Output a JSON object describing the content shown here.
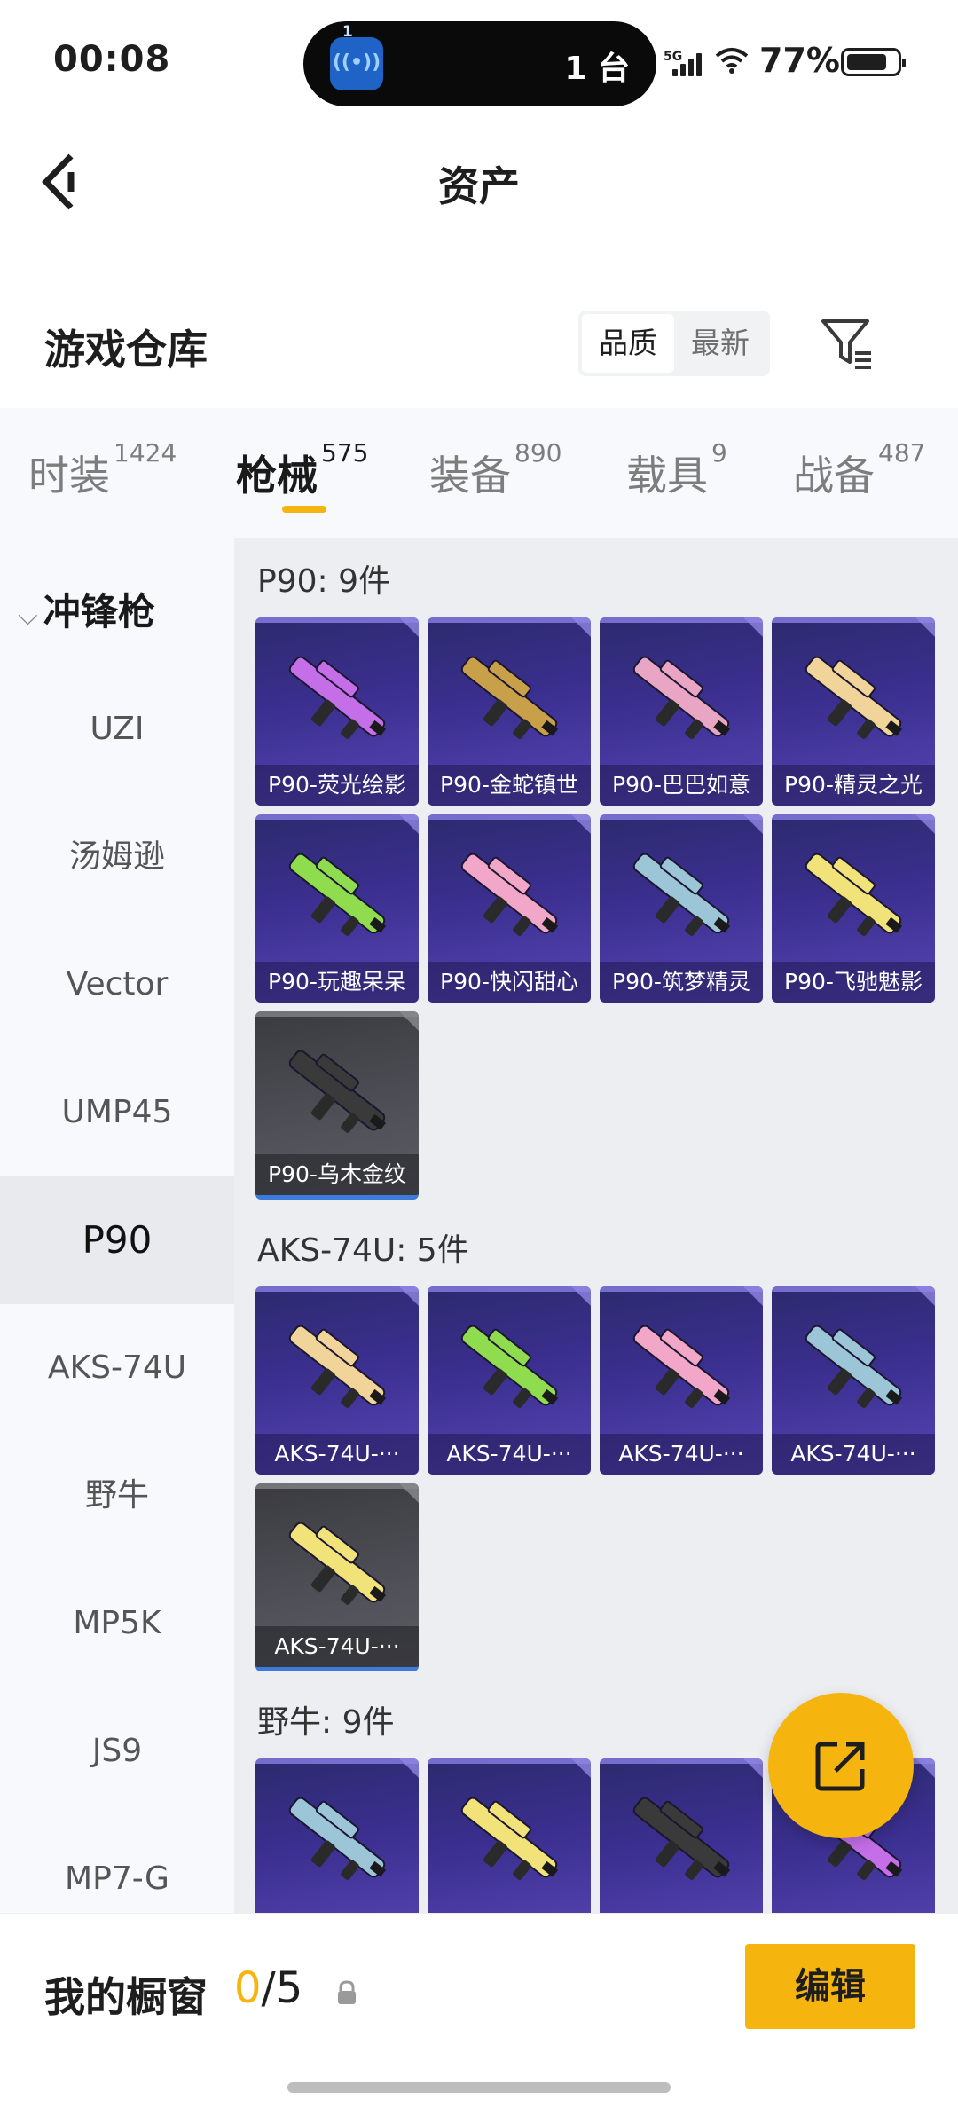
{
  "status_bar": {
    "time": "00:08",
    "island_badge": "1",
    "island_text": "1 台",
    "network": "5G",
    "battery": "77%"
  },
  "header": {
    "title": "资产"
  },
  "section": {
    "title": "游戏仓库",
    "sort_options": [
      "品质",
      "最新"
    ],
    "active_sort": "品质"
  },
  "tabs": [
    {
      "label": "时装",
      "count": "1424"
    },
    {
      "label": "枪械",
      "count": "575"
    },
    {
      "label": "装备",
      "count": "890"
    },
    {
      "label": "载具",
      "count": "9"
    },
    {
      "label": "战备",
      "count": "487"
    }
  ],
  "active_tab": "枪械",
  "sidebar": {
    "category": "冲锋枪",
    "items": [
      "UZI",
      "汤姆逊",
      "Vector",
      "UMP45",
      "P90",
      "AKS-74U",
      "野牛",
      "MP5K",
      "JS9",
      "MP7-G"
    ],
    "active_item": "P90"
  },
  "groups": [
    {
      "title": "P90: 9件",
      "items": [
        {
          "label": "P90-荧光绘影",
          "tier": "purple"
        },
        {
          "label": "P90-金蛇镇世",
          "tier": "purple"
        },
        {
          "label": "P90-巴巴如意",
          "tier": "purple"
        },
        {
          "label": "P90-精灵之光",
          "tier": "purple"
        },
        {
          "label": "P90-玩趣呆呆",
          "tier": "purple"
        },
        {
          "label": "P90-快闪甜心",
          "tier": "purple"
        },
        {
          "label": "P90-筑梦精灵",
          "tier": "purple"
        },
        {
          "label": "P90-飞驰魅影",
          "tier": "purple"
        },
        {
          "label": "P90-乌木金纹",
          "tier": "dark"
        }
      ]
    },
    {
      "title": "AKS-74U: 5件",
      "items": [
        {
          "label": "AKS-74U-···",
          "tier": "purple"
        },
        {
          "label": "AKS-74U-···",
          "tier": "purple"
        },
        {
          "label": "AKS-74U-···",
          "tier": "purple"
        },
        {
          "label": "AKS-74U-···",
          "tier": "purple"
        },
        {
          "label": "AKS-74U-···",
          "tier": "dark"
        }
      ]
    },
    {
      "title": "野牛: 9件",
      "items": [
        {
          "label": "",
          "tier": "purple"
        },
        {
          "label": "",
          "tier": "purple"
        },
        {
          "label": "",
          "tier": "purple"
        },
        {
          "label": "",
          "tier": "purple"
        }
      ]
    }
  ],
  "bottom_bar": {
    "showcase_label": "我的橱窗",
    "showcase_current": "0",
    "showcase_total": "/5",
    "edit_label": "编辑"
  },
  "colors": {
    "accent": "#f6b40e",
    "card_purple": "#3b2f90",
    "card_dark": "#505058"
  }
}
